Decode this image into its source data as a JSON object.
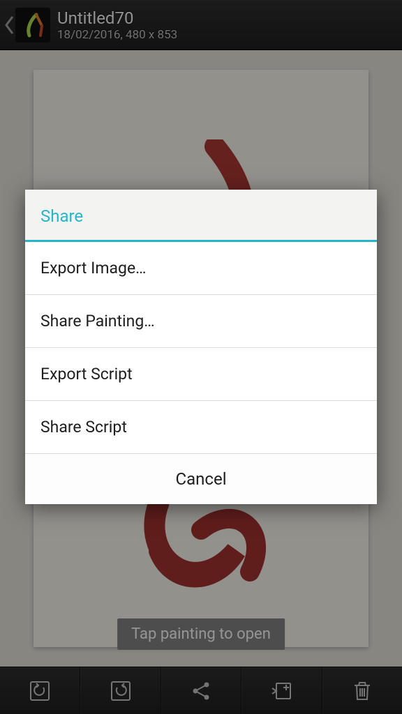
{
  "header": {
    "title": "Untitled70",
    "subtitle": "18/02/2016, 480 x 853"
  },
  "hint": "Tap painting to open",
  "dialog": {
    "title": "Share",
    "options": [
      "Export Image…",
      "Share Painting…",
      "Export Script",
      "Share Script"
    ],
    "cancel": "Cancel"
  }
}
